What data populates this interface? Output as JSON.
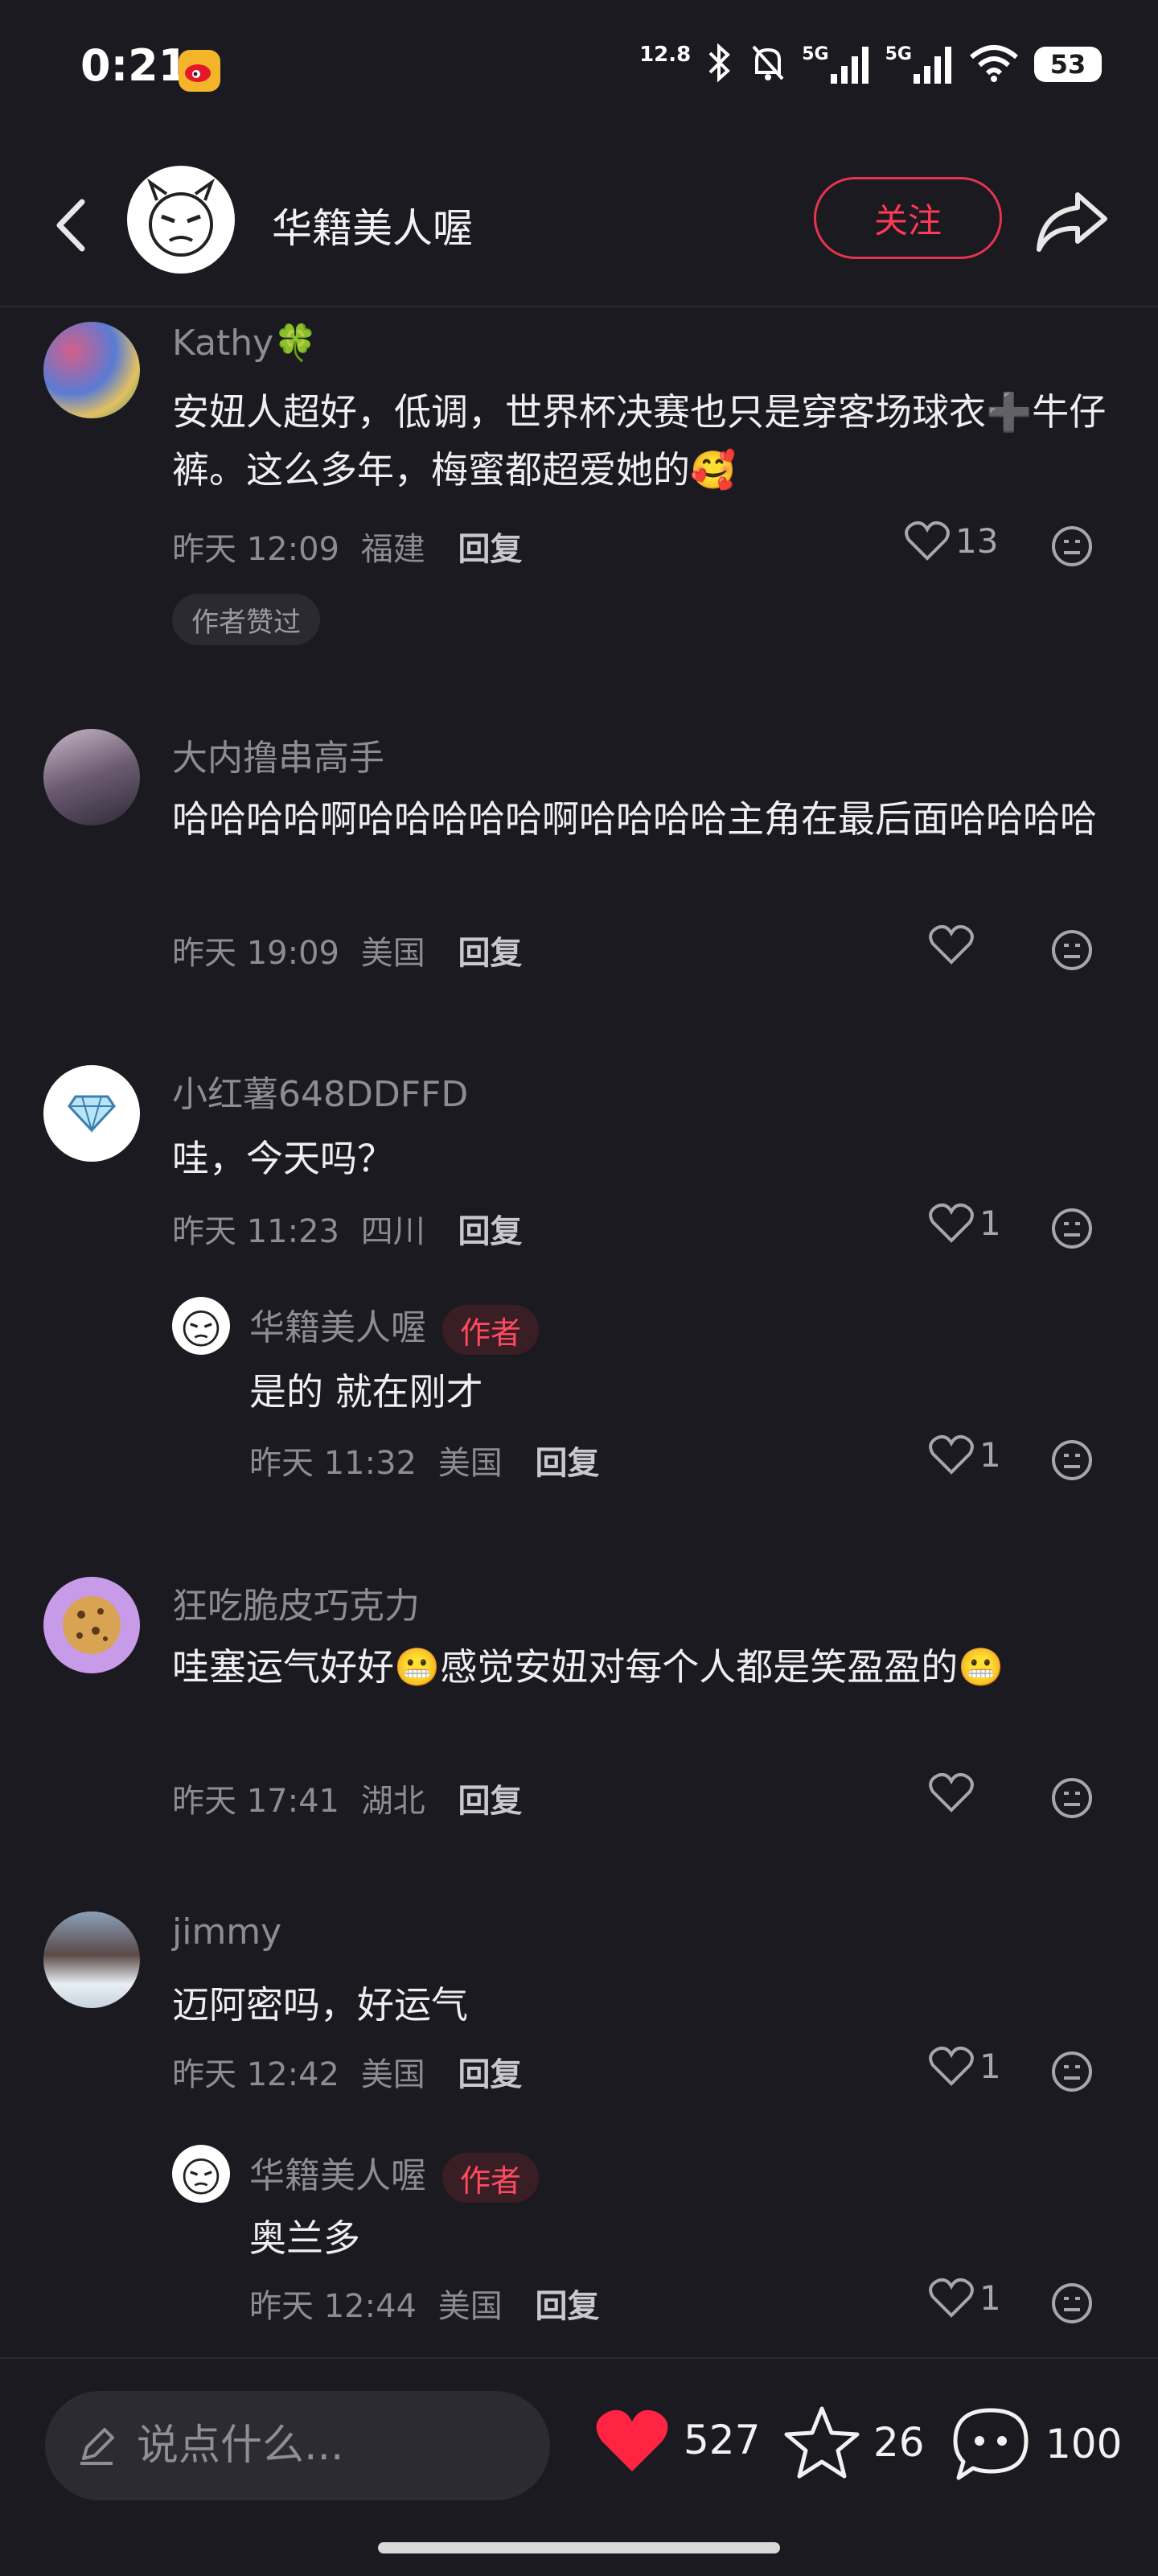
{
  "status_bar": {
    "time": "0:21",
    "net_speed": "12.8",
    "signal_1": "5G",
    "signal_2": "5G",
    "battery": "53"
  },
  "header": {
    "title": "华籍美人喔",
    "follow_label": "关注"
  },
  "comments": [
    {
      "user": "Kathy🍀",
      "text": "安妞人超好，低调，世界杯决赛也只是穿客场球衣➕牛仔裤。这么多年，梅蜜都超爱她的🥰",
      "time": "昨天 12:09",
      "location": "福建",
      "reply_label": "回复",
      "likes": "13",
      "badge": "作者赞过"
    },
    {
      "user": "大内撸串高手",
      "text": "哈哈哈哈啊哈哈哈哈哈啊哈哈哈哈主角在最后面哈哈哈哈",
      "time": "昨天 19:09",
      "location": "美国",
      "reply_label": "回复",
      "likes": ""
    },
    {
      "user": "小红薯648DDFFD",
      "text": "哇，今天吗？",
      "time": "昨天 11:23",
      "location": "四川",
      "reply_label": "回复",
      "likes": "1",
      "reply": {
        "user": "华籍美人喔",
        "author_tag": "作者",
        "text": "是的 就在刚才",
        "time": "昨天 11:32",
        "location": "美国",
        "reply_label": "回复",
        "likes": "1"
      }
    },
    {
      "user": "狂吃脆皮巧克力",
      "text": "哇塞运气好好😬感觉安妞对每个人都是笑盈盈的😬",
      "time": "昨天 17:41",
      "location": "湖北",
      "reply_label": "回复",
      "likes": ""
    },
    {
      "user": "jimmy",
      "text": "迈阿密吗，好运气",
      "time": "昨天 12:42",
      "location": "美国",
      "reply_label": "回复",
      "likes": "1",
      "reply": {
        "user": "华籍美人喔",
        "author_tag": "作者",
        "text": "奥兰多",
        "time": "昨天 12:44",
        "location": "美国",
        "reply_label": "回复",
        "likes": "1"
      }
    }
  ],
  "bottom_bar": {
    "input_placeholder": "说点什么...",
    "likes": "527",
    "favorites": "26",
    "comments": "100"
  },
  "colors": {
    "background": "#1b1a20",
    "accent": "#ff2442",
    "text_secondary": "#8d8c93"
  }
}
